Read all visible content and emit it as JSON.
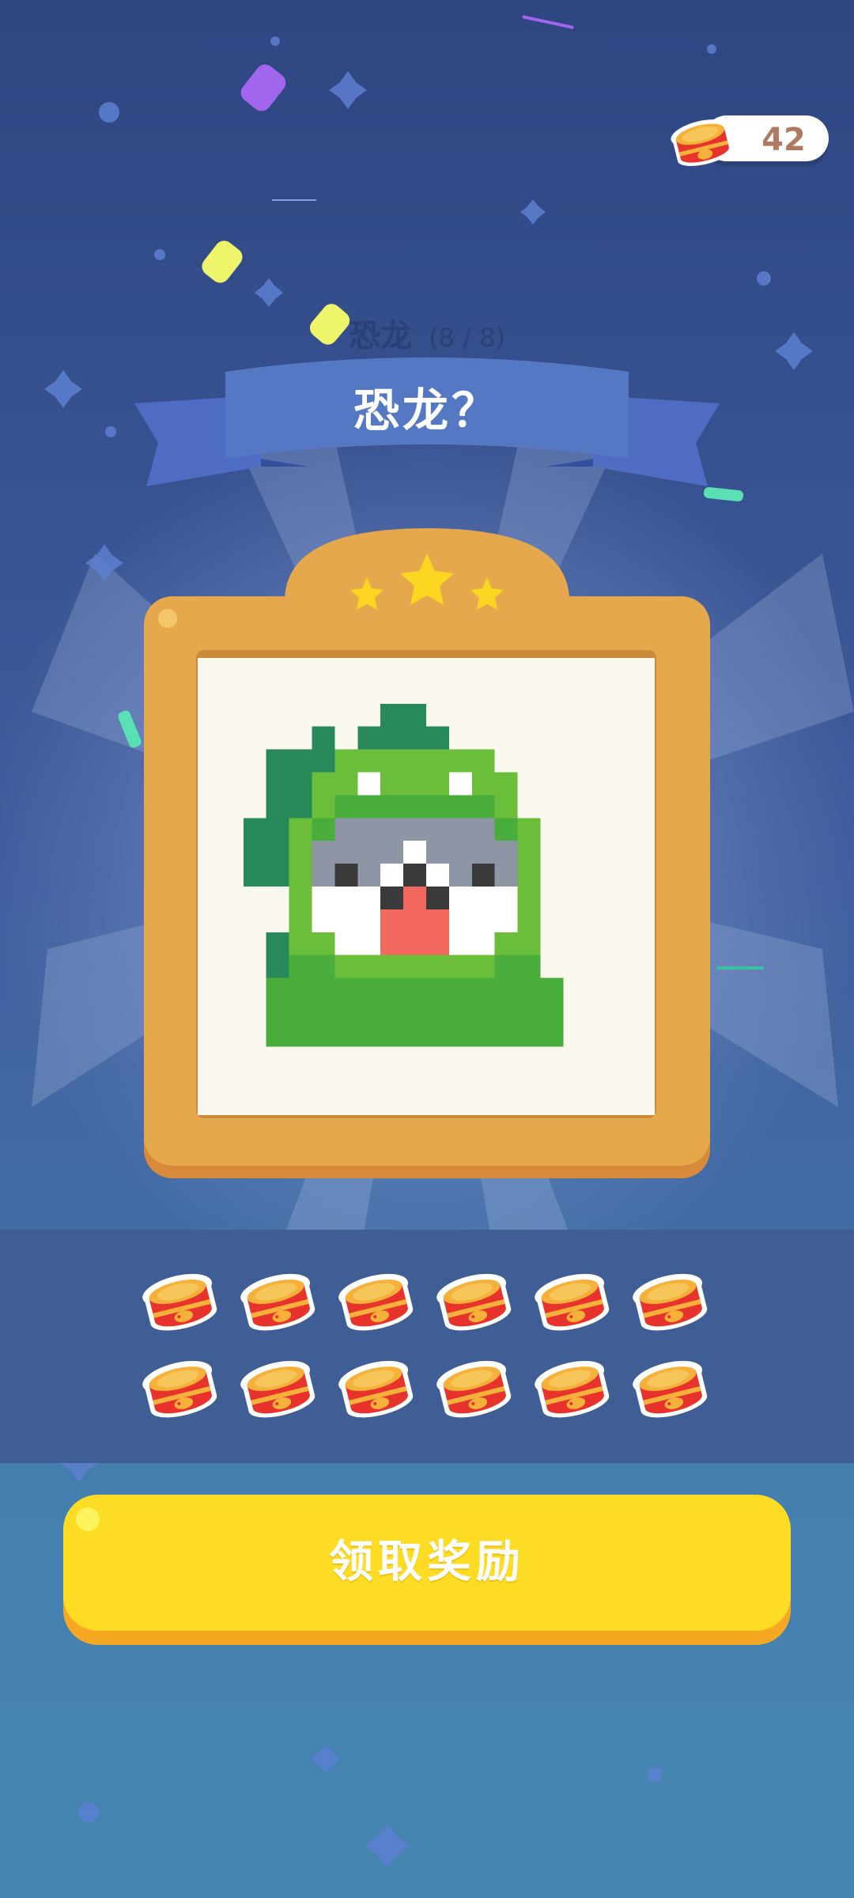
{
  "currency": {
    "coin_count": "42",
    "icon": "fish-can-icon"
  },
  "level": {
    "name": "恐龙",
    "progress": "(8 / 8)"
  },
  "banner": {
    "title": "恐龙？"
  },
  "frame": {
    "stars": 3
  },
  "rewards": {
    "item_icon": "fish-can-icon",
    "count": 12,
    "rows": 2,
    "per_row": 6
  },
  "claim_button": {
    "label": "领取奖励"
  },
  "colors": {
    "background_top": "#2e4682",
    "background_bottom": "#4a8ab6",
    "banner": "#5578c4",
    "frame": "#e6a84c",
    "button": "#fedc24",
    "dino_dark": "#288a5a",
    "dino_mid": "#48ad3a",
    "dino_light": "#6abe3a"
  }
}
